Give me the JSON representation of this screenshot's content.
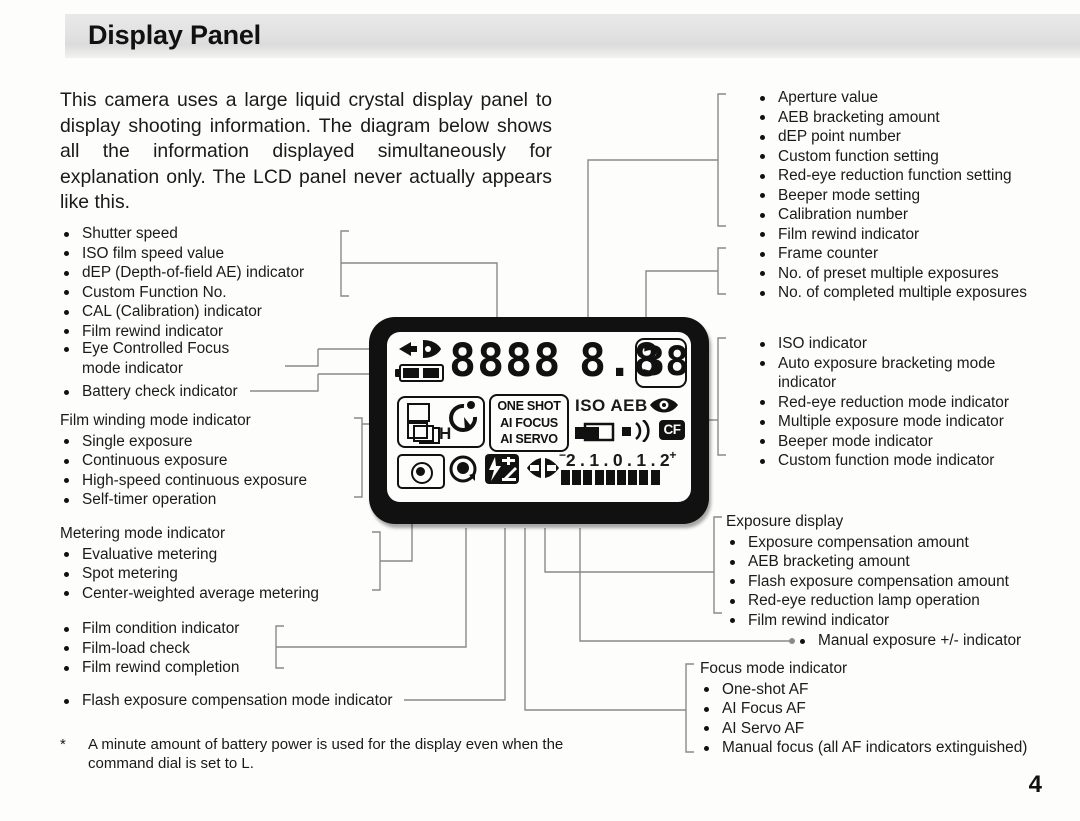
{
  "header": {
    "title": "Display Panel"
  },
  "intro": "This camera uses a large liquid crystal display panel to display shooting information. The diagram below shows all the information displayed simultaneously for explanation only. The LCD panel never actually appears like this.",
  "page_number": "4",
  "footnote": {
    "marker": "*",
    "text": "A minute amount of battery power is used for the display even when the command dial is set to L."
  },
  "callouts": {
    "top_left": {
      "items": [
        "Shutter speed",
        "ISO film speed value",
        "dEP (Depth-of-field AE) indicator",
        "Custom Function No.",
        "CAL (Calibration) indicator",
        "Film rewind indicator"
      ]
    },
    "eye_control": {
      "line1": "Eye Controlled Focus",
      "line2": "mode indicator"
    },
    "battery_check": {
      "label": "Battery check indicator"
    },
    "film_winding": {
      "head": "Film winding mode indicator",
      "items": [
        "Single exposure",
        "Continuous exposure",
        "High-speed continuous exposure",
        "Self-timer operation"
      ]
    },
    "metering": {
      "head": "Metering mode indicator",
      "items": [
        "Evaluative metering",
        "Spot metering",
        "Center-weighted average metering"
      ]
    },
    "film_condition": {
      "items": [
        "Film condition indicator",
        "Film-load check",
        "Film rewind completion"
      ]
    },
    "flash_comp": {
      "label": "Flash exposure compensation mode indicator"
    },
    "top_right": {
      "items": [
        "Aperture value",
        "AEB bracketing amount",
        "dEP point number",
        "Custom function setting",
        "Red-eye reduction function setting",
        "Beeper mode setting",
        "Calibration number",
        "Film rewind indicator"
      ]
    },
    "frame_counter": {
      "items": [
        "Frame counter",
        "No. of preset multiple exposures",
        "No. of completed multiple exposures"
      ]
    },
    "iso_indicator": {
      "items": [
        "ISO indicator",
        "Auto exposure bracketing mode",
        "indicator",
        "Red-eye reduction mode indicator",
        "Multiple exposure mode indicator",
        "Beeper mode indicator",
        "Custom function mode indicator"
      ]
    },
    "exposure_display": {
      "head": "Exposure display",
      "items": [
        "Exposure compensation amount",
        "AEB bracketing amount",
        "Flash exposure compensation amount",
        "Red-eye reduction lamp operation",
        "Film rewind indicator"
      ]
    },
    "manual_exposure": {
      "label": "Manual exposure +/- indicator"
    },
    "focus_mode": {
      "head": "Focus mode indicator",
      "items": [
        "One-shot AF",
        "AI Focus AF",
        "AI Servo AF",
        "Manual focus (all AF indicators extinguished)"
      ]
    }
  },
  "lcd": {
    "main_digits": "8888",
    "aperture_digits": "8.8",
    "frame_counter_digits": "38",
    "af_modes": [
      "ONE SHOT",
      "AI FOCUS",
      "AI SERVO"
    ],
    "iso_aeb_label": "ISO AEB",
    "cf_label": "CF",
    "high_speed_label": "H",
    "exposure_scale": "2 . 1 . 0 . 1 . 2",
    "scale_minus": "−",
    "scale_plus": "+",
    "scale_bars": 9
  }
}
